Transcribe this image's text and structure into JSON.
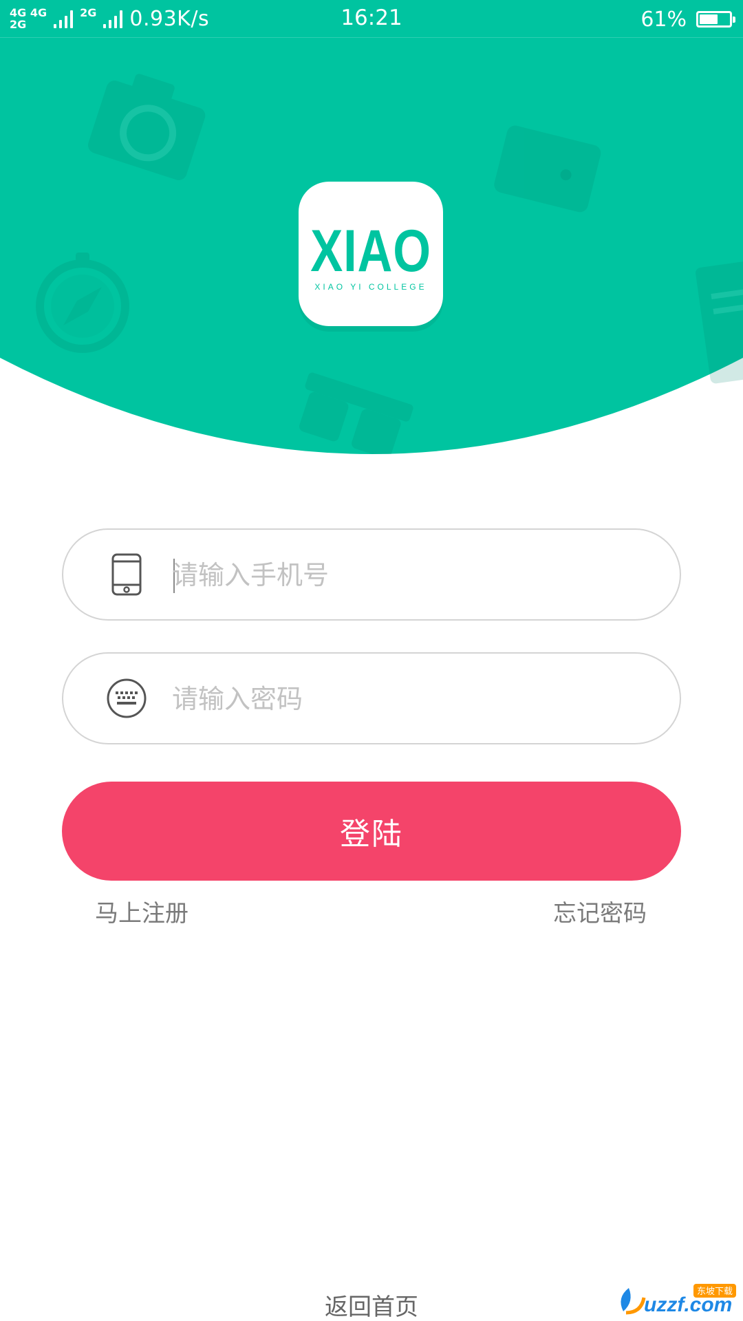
{
  "status_bar": {
    "net_top": "4G 4G",
    "net_bottom": "2G",
    "net_small": "2G",
    "speed": "0.93K/s",
    "time": "16:21",
    "battery_text": "61%",
    "battery_level": 0.61
  },
  "logo": {
    "word": "XIAO",
    "subtitle": "XIAO YI COLLEGE"
  },
  "form": {
    "phone_placeholder": "请输入手机号",
    "password_placeholder": "请输入密码",
    "login_label": "登陆",
    "register_label": "马上注册",
    "forgot_label": "忘记密码"
  },
  "footer": {
    "back_home_label": "返回首页"
  },
  "watermark": {
    "text": "uzzf.com",
    "tag": "东坡下载"
  },
  "colors": {
    "brand_teal": "#00c4a0",
    "login_red": "#f4446a",
    "field_border": "#d4d4d4",
    "placeholder": "#c2c2c2"
  },
  "icons": {
    "phone": "phone-icon",
    "password": "keyboard-icon"
  }
}
